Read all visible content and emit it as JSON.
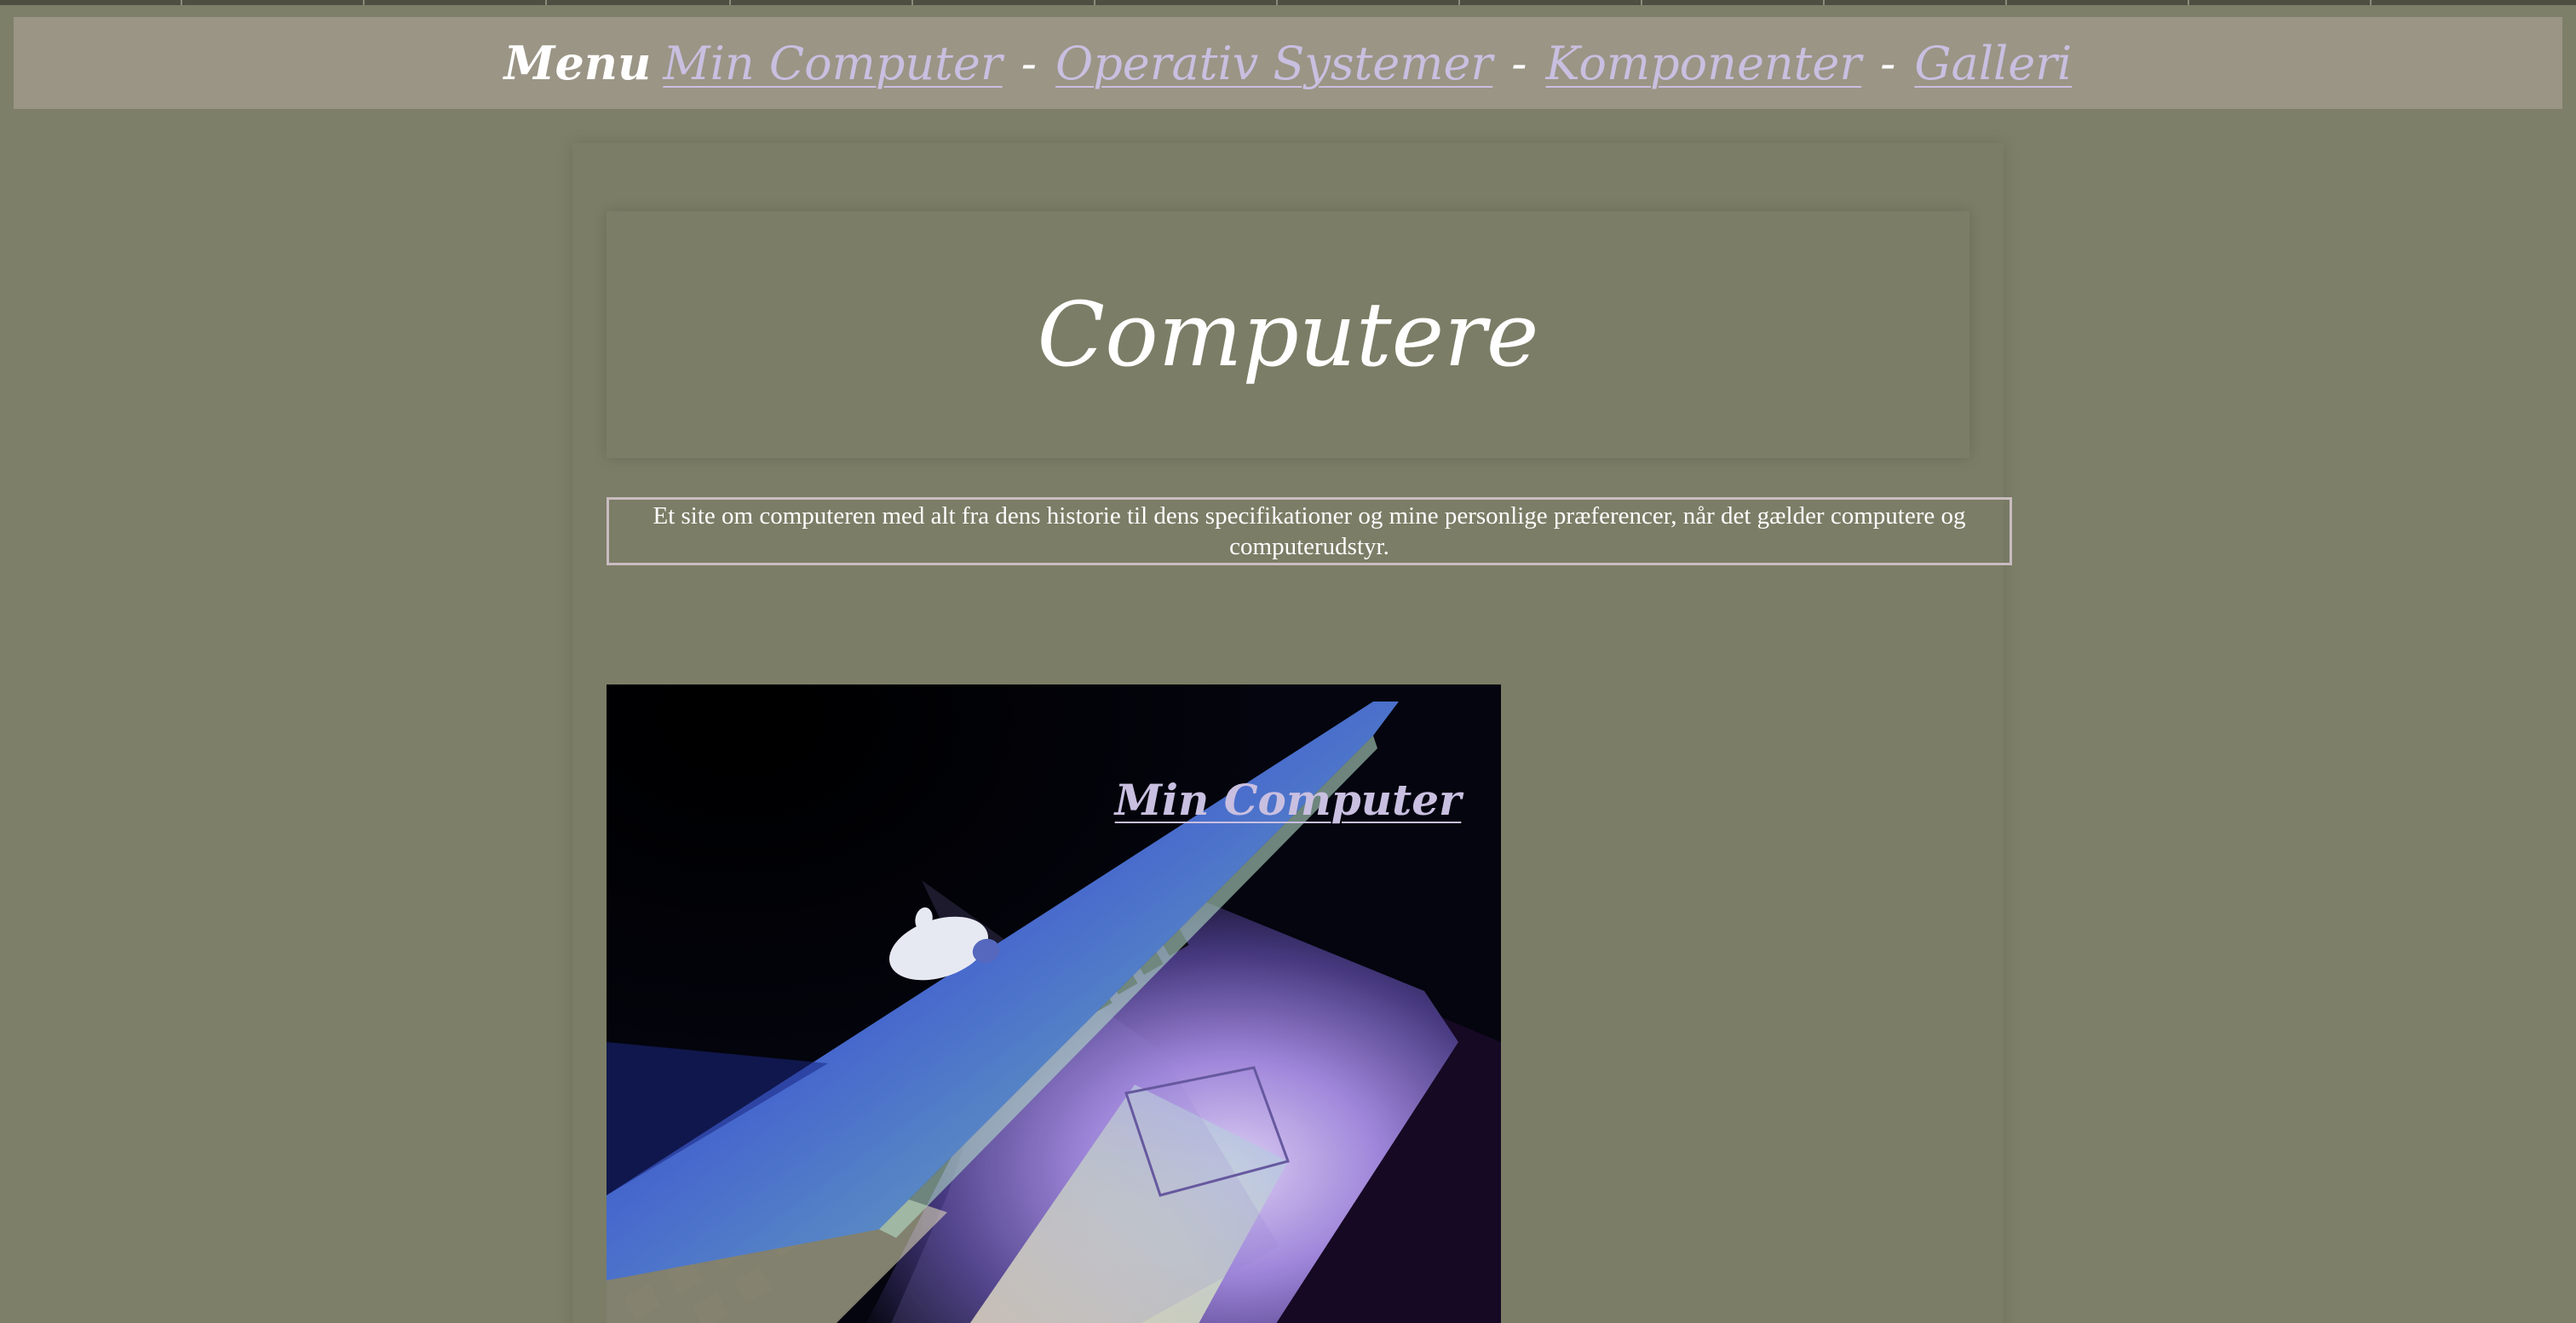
{
  "nav": {
    "title": "Menu",
    "links": [
      {
        "label": "Min Computer"
      },
      {
        "label": "Operativ Systemer"
      },
      {
        "label": "Komponenter"
      },
      {
        "label": "Galleri"
      }
    ],
    "separator": "-"
  },
  "header": {
    "title": "Computere"
  },
  "intro": {
    "text": "Et site om computeren med alt fra dens historie til dens specifikationer og mine personlige præferencer, når det gælder computere og computerudstyr."
  },
  "section": {
    "heading_link": "Min Computer"
  },
  "image": {
    "subject": "laptop-photo"
  },
  "colors": {
    "background": "#7d7f68",
    "navbar": "#9a9585",
    "link": "#c9bfe0",
    "text": "#ffffff",
    "intro_border": "#c9bcc0"
  }
}
